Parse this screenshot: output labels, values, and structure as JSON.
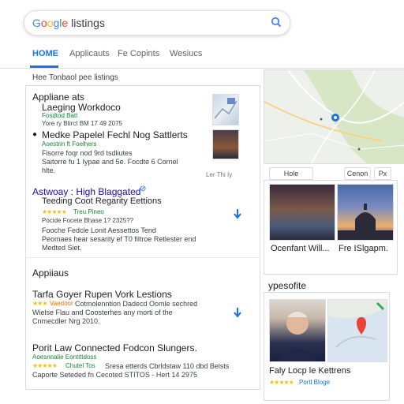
{
  "search": {
    "brand": "Google",
    "query": "listings"
  },
  "nav": {
    "tabs": [
      "HOME",
      "Applicauts",
      "Fe Copints",
      "Wesiucs"
    ]
  },
  "breadcrumb": "Hee Tonbaol pee listings",
  "card1": {
    "heading": "Appliane ats",
    "r1": {
      "title": "Laeging Workdoco",
      "green": "Fosdtod Batt",
      "meta": "Yore ry Btirct BM 17 49 2075"
    },
    "r2": {
      "title": "Medke Papelel Fechl Nog Sattlerts",
      "green": "Aoestrin ft Foelhers",
      "body1": "Fisorre foqr nod 9rd tsdliutes",
      "body2": "Saitorre fu 1 Iypae and 5e. Focdte 6 Cornel",
      "body3": "hlte.",
      "side": "Ler Thi Iy"
    },
    "r3": {
      "title": "Astwoay : High Blaggated",
      "green": "Teeding Coot Regarity Eettions",
      "rating": "Treu Pineo",
      "meta": "Pocide Focete Bhase 1? 2325??",
      "body1": "Fooche Fedcle Lonit Aessettos Tend",
      "body2": "Peomaes hear sesarity ef T0 filtroe Retlester end",
      "body3": "Medted Siet."
    }
  },
  "card2": {
    "heading": "Appiiaus",
    "r4": {
      "title": "Tarfa Goyer Rupen Vork Lestions",
      "green": "Vaedoor",
      "desc": "Cotmolenntion Dadecd Oomle sechred",
      "body1": "Wielse Flau and Coosterhes any morti of the",
      "body2": "Cnmecdler Nrg 2010."
    },
    "r5": {
      "title": "Porit Law Connected Fodcon Slungers.",
      "green": "Aoesnnalie Eontittdoss",
      "rating": "Chutel Tos",
      "meta": "Sresa etterds Cbrldstaw 110 dbd Belsts",
      "body1": "Caporte Seteded fn Cecoted STITOS - Hert 14 2975"
    }
  },
  "right": {
    "btn_left": "Hole",
    "btn_mid": "Cenon",
    "btn_right": "Px",
    "photo1_caption": "Ocenfant Will...",
    "photo2_caption": "Fre ISlgapm.",
    "section_title": "ypesofite",
    "person_title": "Faly Locp le Kettrens",
    "person_sub": "Portl Bloge"
  },
  "colors": {
    "accent": "#1a73e8",
    "green": "#188038",
    "star": "#fbbc05"
  }
}
